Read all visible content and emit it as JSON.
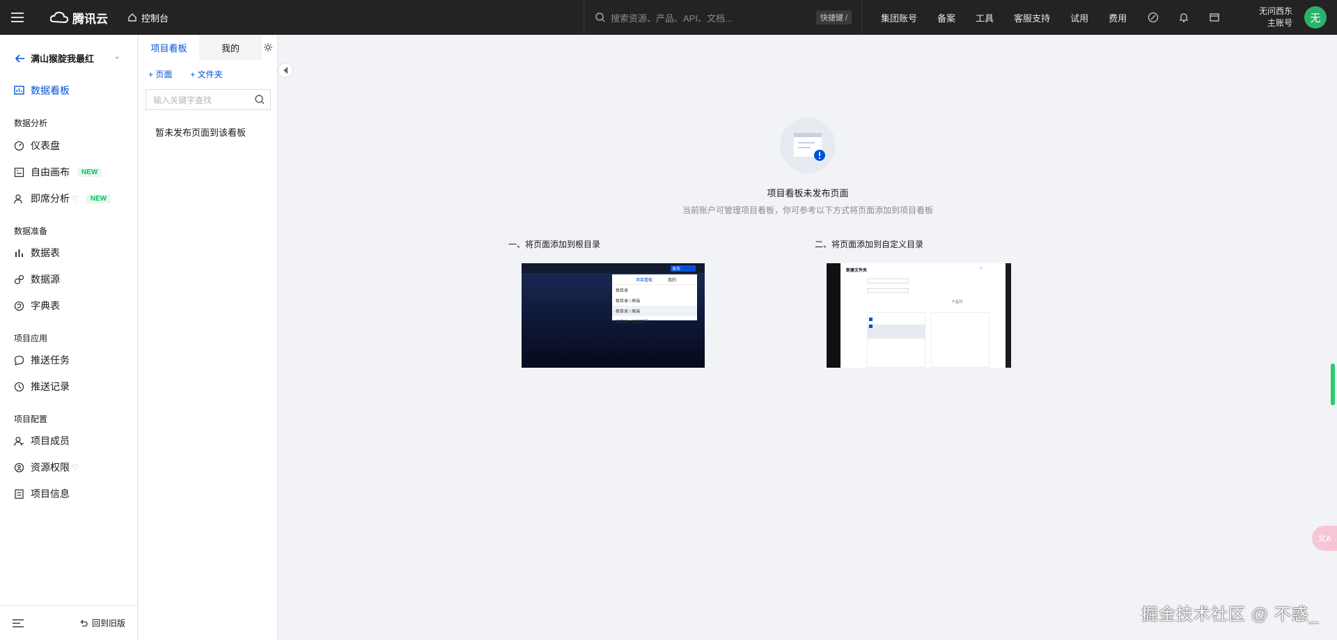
{
  "topbar": {
    "brand": "腾讯云",
    "console": "控制台",
    "search_placeholder": "搜索资源、产品、API、文档...",
    "shortcut": "快捷键 /",
    "nav": [
      "集团账号",
      "备案",
      "工具",
      "客服支持",
      "试用",
      "费用"
    ],
    "account_name": "无问西东",
    "account_type": "主账号",
    "avatar_text": "无"
  },
  "sidebar": {
    "project": "满山猴腚我最红",
    "dashboard": "数据看板",
    "groups": {
      "analysis": "数据分析",
      "prep": "数据准备",
      "apps": "项目应用",
      "config": "项目配置"
    },
    "items": {
      "panel": "仪表盘",
      "canvas": "自由画布",
      "adhoc": "即席分析",
      "table": "数据表",
      "source": "数据源",
      "dict": "字典表",
      "push_task": "推送任务",
      "push_log": "推送记录",
      "members": "项目成员",
      "perm": "资源权限",
      "info": "项目信息"
    },
    "badge_new": "NEW",
    "back_old": "回到旧版"
  },
  "panel2": {
    "tab_project": "项目看板",
    "tab_mine": "我的",
    "add_page": "+ 页面",
    "add_folder": "+ 文件夹",
    "search_placeholder": "输入关键字查找",
    "empty": "暂未发布页面到该看板"
  },
  "main": {
    "empty_title": "项目看板未发布页面",
    "empty_desc": "当前账户可管理项目看板，你可参考以下方式将页面添加到项目看板",
    "guide1": "一、将页面添加到根目录",
    "guide2": "二、将页面添加到自定义目录",
    "shot1": {
      "publish": "发布",
      "tab_a": "项目看板",
      "tab_b": "我的",
      "rows": [
        "根目录",
        "根目录 / 高端",
        "根目录 / 高端",
        "根目录 / 运营部门"
      ]
    },
    "shot2": {
      "title": "新建文件夹",
      "label_col": "产品列"
    }
  },
  "watermark": "掘金技术社区 @ 不惑_",
  "colors": {
    "accent": "#0052d9",
    "topbar": "#232323",
    "avatar": "#29b36a",
    "new_badge": "#0abf5b"
  }
}
